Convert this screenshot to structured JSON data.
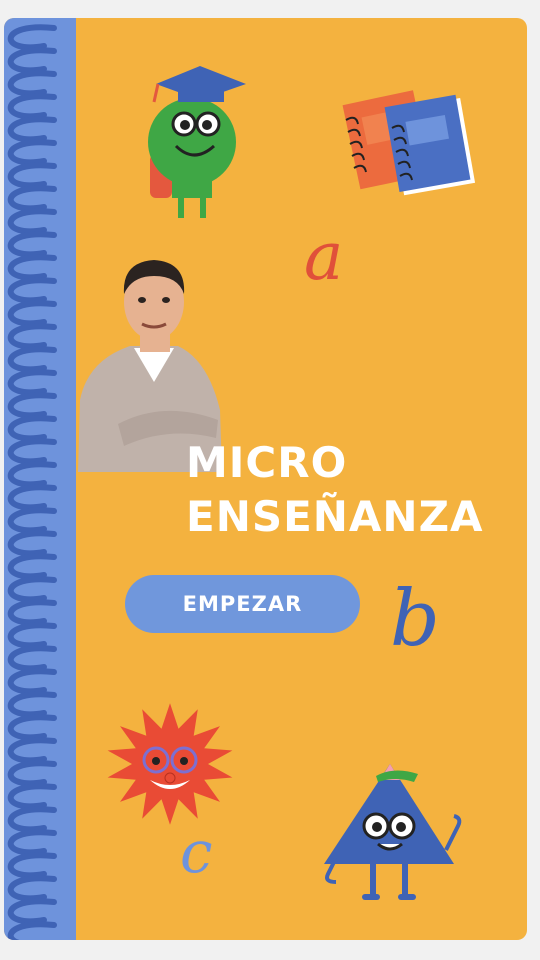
{
  "title": {
    "line1": "MICRO",
    "line2": "ENSEÑANZA"
  },
  "start_button": {
    "label": "EMPEZAR"
  },
  "letters": {
    "a": "a",
    "b": "b",
    "c": "c"
  },
  "colors": {
    "background": "#f4b23f",
    "spine": "#6e93dc",
    "coil": "#3f63b5",
    "button": "#7097dc",
    "title_text": "#ffffff",
    "letter_a": "#e0503a",
    "letter_b": "#3f63b5",
    "letter_c": "#6e93dc"
  },
  "icons": [
    "graduate-monster-icon",
    "notebooks-icon",
    "teacher-avatar",
    "sun-face-icon",
    "triangle-monster-icon",
    "spiral-coil"
  ]
}
